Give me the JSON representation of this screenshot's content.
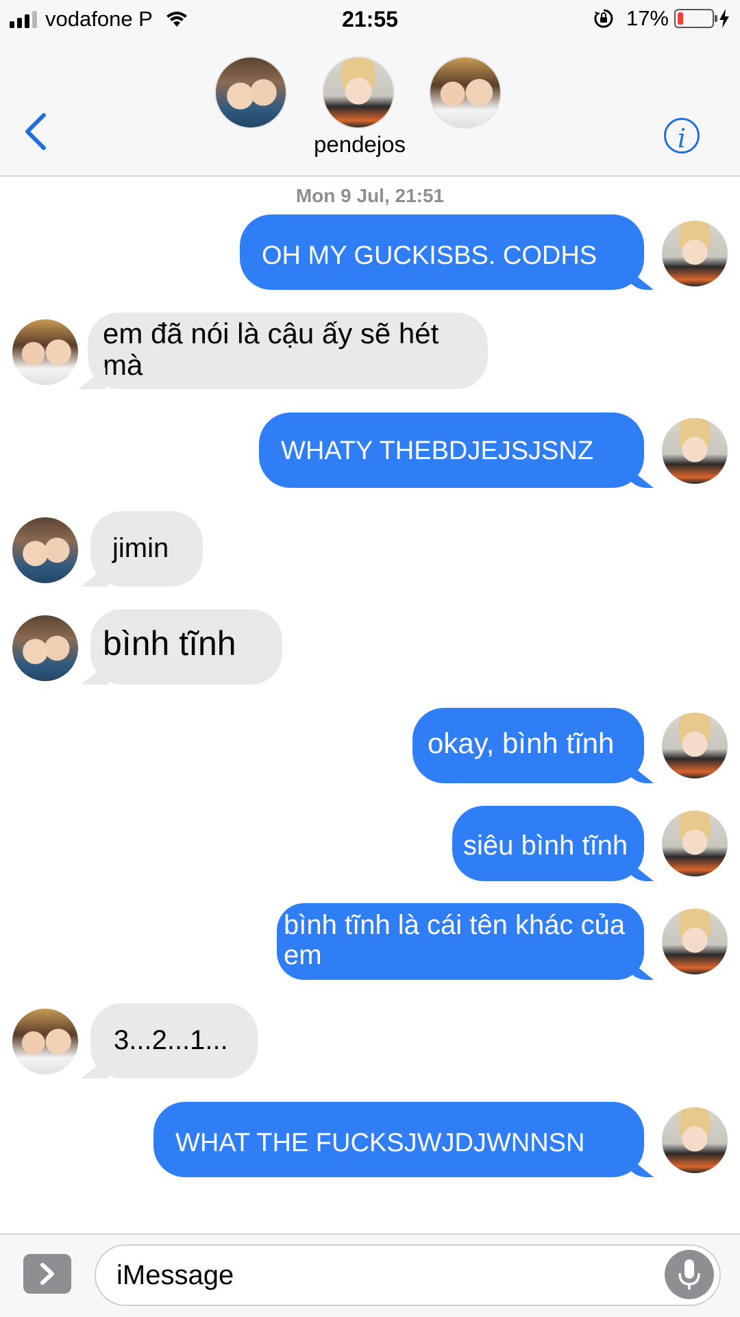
{
  "status_bar": {
    "carrier": "vodafone P",
    "time": "21:55",
    "battery_percent_text": "17%",
    "battery_level": 0.17
  },
  "header": {
    "group_name": "pendejos",
    "info_glyph": "i",
    "back_icon": "chevron-left-icon",
    "accent_color": "#1f6fde"
  },
  "conversation": {
    "timestamp": "Mon 9 Jul, 21:51",
    "messages": [
      {
        "direction": "out",
        "text": "OH MY GUCKISBS. CODHS"
      },
      {
        "direction": "in",
        "text": "em đã nói là cậu ấy sẽ hét mà"
      },
      {
        "direction": "out",
        "text": "WHATY THEBDJEJSJSNZ"
      },
      {
        "direction": "in",
        "text": "jimin"
      },
      {
        "direction": "in",
        "text": "bình tĩnh"
      },
      {
        "direction": "out",
        "text": "okay, bình tĩnh"
      },
      {
        "direction": "out",
        "text": "siêu bình tĩnh"
      },
      {
        "direction": "out",
        "text": "bình tĩnh là cái tên khác của em"
      },
      {
        "direction": "in",
        "text": "3...2...1..."
      },
      {
        "direction": "out",
        "text": "WHAT THE FUCKSJWJDJWNNSN"
      }
    ],
    "outgoing_color": "#2f7ef5",
    "incoming_color": "#e9e9eb"
  },
  "compose": {
    "placeholder": "iMessage"
  }
}
